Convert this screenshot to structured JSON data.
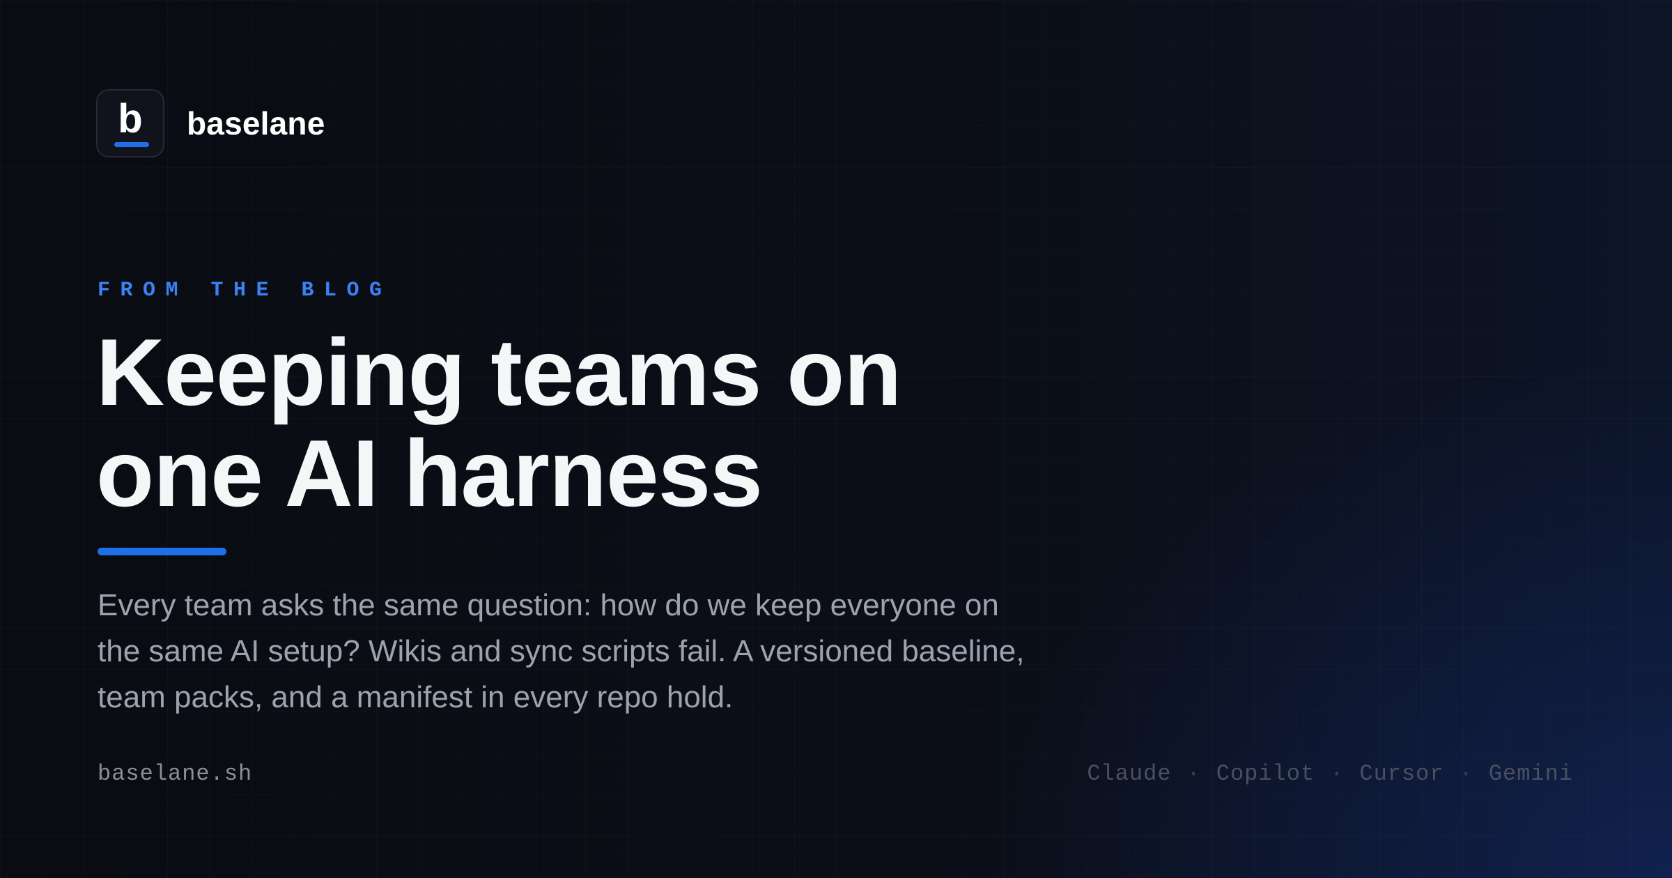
{
  "brand": {
    "logo_letter": "b",
    "name": "baselane"
  },
  "hero": {
    "eyebrow": "FROM THE BLOG",
    "title_line_1": "Keeping teams on",
    "title_line_2": "one AI harness",
    "summary": "Every team asks the same question: how do we keep everyone on the same AI setup? Wikis and sync scripts fail. A versioned baseline, team packs, and a manifest in every repo hold."
  },
  "footer": {
    "site": "baselane.sh",
    "separator": "·",
    "tools": [
      "Claude",
      "Copilot",
      "Cursor",
      "Gemini"
    ]
  },
  "colors": {
    "accent": "#1f6fe8",
    "eyebrow": "#3b82f6",
    "background": "#0b0d14",
    "title": "#f5f6f8",
    "body_text": "#9ca3af"
  }
}
